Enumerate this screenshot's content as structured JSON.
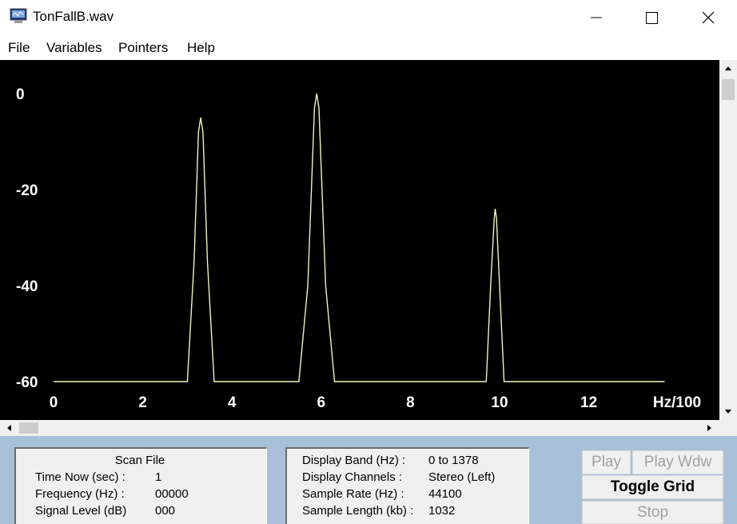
{
  "window": {
    "title": "TonFallB.wav",
    "icon": "monitor-app-icon",
    "controls": [
      "minimize-icon",
      "maximize-icon",
      "close-icon"
    ]
  },
  "menu": {
    "file": "File",
    "variables": "Variables",
    "pointers": "Pointers",
    "help": "Help"
  },
  "chart_data": {
    "type": "line",
    "title": "",
    "xlabel": "Hz/100",
    "ylabel": "",
    "x_ticks": [
      "0",
      "2",
      "4",
      "6",
      "8",
      "10",
      "12"
    ],
    "y_ticks": [
      "0",
      "-20",
      "-40",
      "-60"
    ],
    "xlim": [
      0,
      14.8
    ],
    "ylim": [
      -60,
      0
    ],
    "background": "#000000",
    "line_color": "#f2f2c0",
    "grid": false,
    "x": [
      0,
      3.0,
      3.15,
      3.25,
      3.3,
      3.35,
      3.45,
      3.6,
      5.5,
      5.7,
      5.85,
      5.9,
      5.95,
      6.1,
      6.3,
      9.7,
      9.8,
      9.88,
      9.9,
      9.93,
      10.0,
      10.1,
      13.7
    ],
    "y": [
      -60,
      -60,
      -35,
      -8,
      -5,
      -8,
      -35,
      -60,
      -60,
      -40,
      -3,
      0,
      -3,
      -40,
      -60,
      -60,
      -40,
      -26,
      -24,
      -26,
      -40,
      -60,
      -60
    ]
  },
  "scan_panel": {
    "title": "Scan File",
    "rows": [
      {
        "label": "Time Now (sec) :",
        "value": "1"
      },
      {
        "label": "Frequency (Hz) :",
        "value": "00000"
      },
      {
        "label": "Signal Level (dB)",
        "value": "000"
      }
    ]
  },
  "info_panel": {
    "rows": [
      {
        "label": "Display Band (Hz) :",
        "value": "0 to 1378"
      },
      {
        "label": "Display Channels :",
        "value": "Stereo (Left)"
      },
      {
        "label": "Sample Rate (Hz) :",
        "value": "44100"
      },
      {
        "label": "Sample Length (kb) :",
        "value": "1032"
      }
    ]
  },
  "buttons": {
    "play": "Play",
    "play_window": "Play Wdw",
    "toggle_grid": "Toggle Grid",
    "stop": "Stop"
  },
  "colors": {
    "bottom_background": "#a9c0d9",
    "panel_background": "#f0f0f0",
    "disabled_text": "#a0a0a0"
  }
}
